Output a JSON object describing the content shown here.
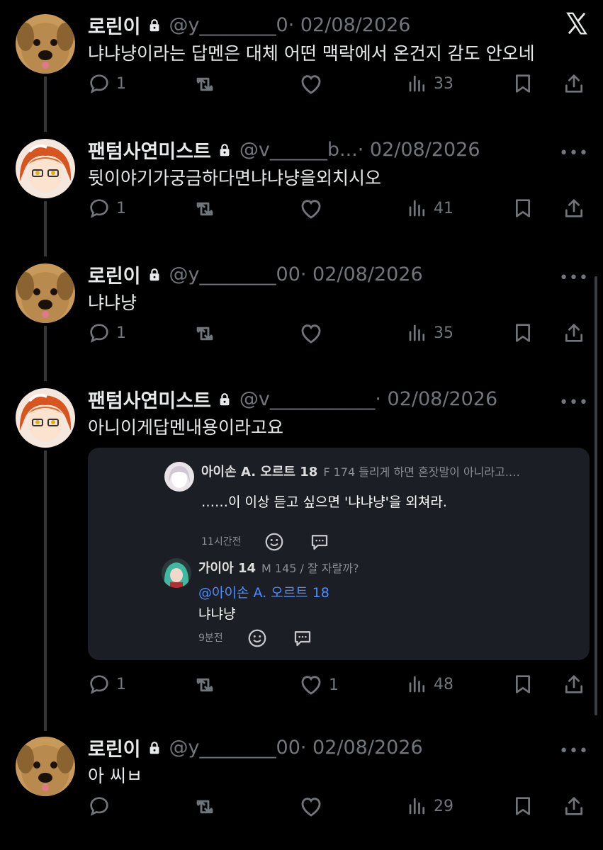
{
  "tweets": [
    {
      "name": "로린이",
      "handle": "@y________0",
      "date": "· 02/08/2026",
      "text": "냐냐냥이라는 답멘은 대체 어떤 맥락에서 온건지 감도 안오네",
      "replies": "1",
      "likes": "",
      "views": "33"
    },
    {
      "name": "팬텀사연미스트",
      "handle": "@v______b...",
      "date": "· 02/08/2026",
      "text": "뒷이야기가궁금하다면냐냐냥을외치시오",
      "replies": "1",
      "likes": "",
      "views": "41"
    },
    {
      "name": "로린이",
      "handle": "@y________00",
      "date": "· 02/08/2026",
      "text": "냐냐냥",
      "replies": "1",
      "likes": "",
      "views": "35"
    },
    {
      "name": "팬텀사연미스트",
      "handle": "@v___________",
      "date": "· 02/08/2026",
      "text": "아니이게답멘내용이라고요",
      "replies": "1",
      "likes": "1",
      "views": "48"
    },
    {
      "name": "로린이",
      "handle": "@y________00",
      "date": "· 02/08/2026",
      "text": "아 씨ㅂ",
      "replies": "",
      "likes": "",
      "views": "29"
    }
  ],
  "quote": {
    "comments": [
      {
        "name": "아이손 A. 오르트 18",
        "meta": "F 174 들리게 하면 혼잣말이 아니라고.…",
        "text": "……이 이상 듣고 싶으면 '냐냐냥'을 외쳐라.",
        "mention": "",
        "time": "11시간전"
      },
      {
        "name": "가이아 14",
        "meta": "M 145 / 잘 자랄까?",
        "text": "냐냐냥",
        "mention": "@아이손 A. 오르트 18",
        "time": "9분전"
      }
    ]
  },
  "icons": {
    "logo": "x-logo-icon",
    "more": "more-icon",
    "reply": "reply-icon",
    "retweet": "retweet-icon",
    "like": "like-icon",
    "views": "views-icon",
    "bookmark": "bookmark-icon",
    "share": "share-icon",
    "lock": "lock-icon"
  },
  "colors": {
    "background": "#000000",
    "text": "#e7e9ea",
    "muted": "#71767b",
    "mention": "#4d8dff",
    "quote_bg": "#1c1e25"
  }
}
